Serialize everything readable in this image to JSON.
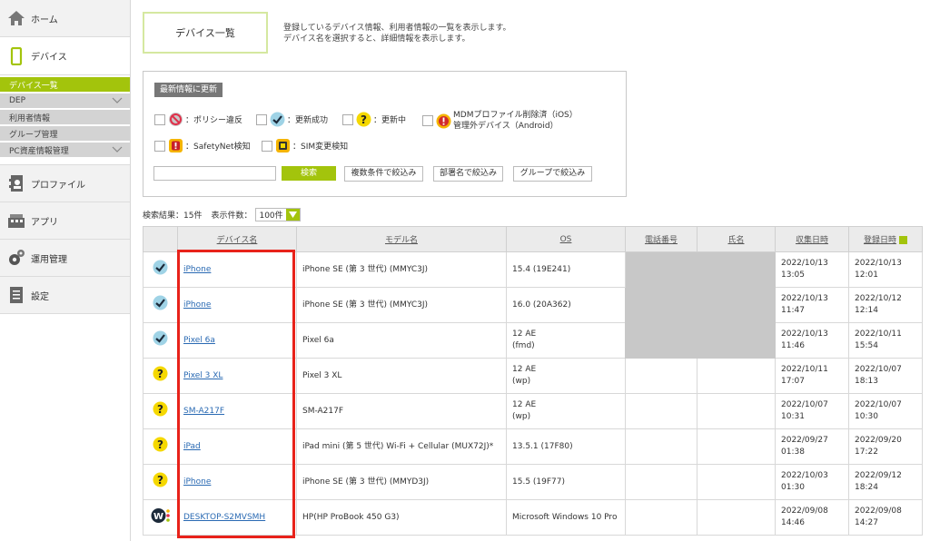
{
  "sidebar": {
    "home": "ホーム",
    "device": "デバイス",
    "sub_items": [
      {
        "label": "デバイス一覧",
        "active": true
      },
      {
        "label": "DEP",
        "expandable": true
      },
      {
        "label": "利用者情報"
      },
      {
        "label": "グループ管理"
      },
      {
        "label": "PC資産情報管理",
        "expandable": true
      }
    ],
    "profile": "プロファイル",
    "apps": "アプリ",
    "ops": "運用管理",
    "settings": "設定"
  },
  "header": {
    "title": "デバイス一覧",
    "desc_line1": "登録しているデバイス情報、利用者情報の一覧を表示します。",
    "desc_line2": "デバイス名を選択すると、詳細情報を表示します。"
  },
  "filter": {
    "refresh_label": "最新情報に更新",
    "status": {
      "policy": "：ポリシー違反",
      "updated": "：更新成功",
      "updating": "：更新中",
      "mdm_line1": "MDMプロファイル削除済（iOS）",
      "mdm_line2": "管理外デバイス（Android）",
      "safetynet": "：SafetyNet検知",
      "sim": "：SIM変更検知"
    },
    "search_value": "",
    "search_label": "検索",
    "multi_label": "複数条件で絞込み",
    "dept_label": "部署名で絞込み",
    "group_label": "グループで絞込み"
  },
  "results": {
    "count_text": "検索結果：15件",
    "per_page_label": "表示件数：",
    "per_page_value": "100件"
  },
  "table": {
    "headers": {
      "device_name": "デバイス名",
      "model": "モデル名",
      "os": "OS",
      "phone": "電話番号",
      "name": "氏名",
      "collected": "収集日時",
      "registered": "登録日時"
    },
    "rows": [
      {
        "status": "updated",
        "device": "iPhone",
        "model": "iPhone SE (第 3 世代) (MMYC3J)",
        "os1": "15.4 (19E241)",
        "os2": "",
        "col1": "2022/10/13",
        "col2": "13:05",
        "reg1": "2022/10/13",
        "reg2": "12:01"
      },
      {
        "status": "updated",
        "device": "iPhone",
        "model": "iPhone SE (第 3 世代) (MMYC3J)",
        "os1": "16.0 (20A362)",
        "os2": "",
        "col1": "2022/10/13",
        "col2": "11:47",
        "reg1": "2022/10/12",
        "reg2": "12:14"
      },
      {
        "status": "updated",
        "device": "Pixel 6a",
        "model": "Pixel 6a",
        "os1": "12 AE",
        "os2": "(fmd)",
        "col1": "2022/10/13",
        "col2": "11:46",
        "reg1": "2022/10/11",
        "reg2": "15:54"
      },
      {
        "status": "updating",
        "device": "Pixel 3 XL",
        "model": "Pixel 3 XL",
        "os1": "12 AE",
        "os2": "(wp)",
        "col1": "2022/10/11",
        "col2": "17:07",
        "reg1": "2022/10/07",
        "reg2": "18:13"
      },
      {
        "status": "updating",
        "device": "SM-A217F",
        "model": "SM-A217F",
        "os1": "12 AE",
        "os2": "(wp)",
        "col1": "2022/10/07",
        "col2": "10:31",
        "reg1": "2022/10/07",
        "reg2": "10:30"
      },
      {
        "status": "updating",
        "device": "iPad",
        "model": "iPad mini (第 5 世代) Wi-Fi + Cellular (MUX72J)*",
        "os1": "13.5.1 (17F80)",
        "os2": "",
        "col1": "2022/09/27",
        "col2": "01:38",
        "reg1": "2022/09/20",
        "reg2": "17:22"
      },
      {
        "status": "updating",
        "device": "iPhone",
        "model": "iPhone SE (第 3 世代) (MMYD3J)",
        "os1": "15.5 (19F77)",
        "os2": "",
        "col1": "2022/10/03",
        "col2": "01:30",
        "reg1": "2022/09/12",
        "reg2": "18:24"
      },
      {
        "status": "windows",
        "device": "DESKTOP-S2MVSMH",
        "model": "HP(HP ProBook 450 G3)",
        "os1": "Microsoft Windows 10 Pro",
        "os2": "",
        "col1": "2022/09/08",
        "col2": "14:46",
        "reg1": "2022/09/08",
        "reg2": "14:27"
      }
    ]
  },
  "colors": {
    "accent": "#a3c40c",
    "link": "#2a6ab3",
    "highlight": "#e8221a",
    "check_badge": "#9fd3e6",
    "question_badge": "#f5d800"
  }
}
